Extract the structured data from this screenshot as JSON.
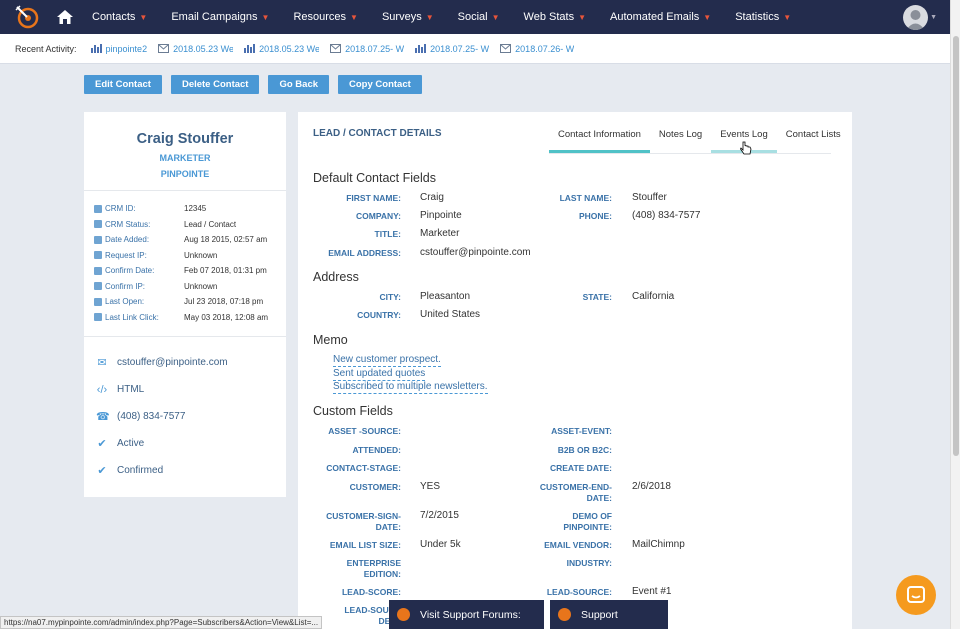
{
  "nav": {
    "items": [
      "Contacts",
      "Email Campaigns",
      "Resources",
      "Surveys",
      "Social",
      "Web Stats",
      "Automated Emails",
      "Statistics"
    ]
  },
  "recent": {
    "label": "Recent Activity:",
    "items": [
      {
        "text": "pinpointe2",
        "icon": "chart-icon"
      },
      {
        "text": "2018.05.23 We",
        "icon": "email-icon"
      },
      {
        "text": "2018.05.23 We",
        "icon": "chart-icon"
      },
      {
        "text": "2018.07.25- W",
        "icon": "email-icon"
      },
      {
        "text": "2018.07.25- W",
        "icon": "chart-icon"
      },
      {
        "text": "2018.07.26- W",
        "icon": "email-icon"
      }
    ]
  },
  "actions": {
    "edit": "Edit Contact",
    "delete": "Delete Contact",
    "back": "Go Back",
    "copy": "Copy Contact"
  },
  "profile": {
    "name": "Craig Stouffer",
    "title": "MARKETER",
    "company": "PINPOINTE",
    "meta": [
      {
        "label": "CRM ID:",
        "value": "12345"
      },
      {
        "label": "CRM Status:",
        "value": "Lead / Contact"
      },
      {
        "label": "Date Added:",
        "value": "Aug 18 2015, 02:57 am"
      },
      {
        "label": "Request IP:",
        "value": "Unknown"
      },
      {
        "label": "Confirm Date:",
        "value": "Feb 07 2018, 01:31 pm"
      },
      {
        "label": "Confirm IP:",
        "value": "Unknown"
      },
      {
        "label": "Last Open:",
        "value": "Jul 23 2018, 07:18 pm"
      },
      {
        "label": "Last Link Click:",
        "value": "May 03 2018, 12:08 am"
      }
    ],
    "contact": {
      "email": "cstouffer@pinpointe.com",
      "format": "HTML",
      "phone": "(408) 834-7577",
      "status": "Active",
      "confirmed": "Confirmed"
    }
  },
  "main": {
    "title": "LEAD / CONTACT DETAILS",
    "tabs": [
      "Contact Information",
      "Notes Log",
      "Events Log",
      "Contact Lists"
    ],
    "sections": {
      "default": "Default Contact Fields",
      "address": "Address",
      "memo": "Memo",
      "custom": "Custom Fields"
    },
    "default_fields": {
      "first_name_label": "FIRST NAME:",
      "first_name": "Craig",
      "last_name_label": "LAST NAME:",
      "last_name": "Stouffer",
      "company_label": "COMPANY:",
      "company": "Pinpointe",
      "phone_label": "PHONE:",
      "phone": "(408) 834-7577",
      "title_label": "TITLE:",
      "title": "Marketer",
      "email_label": "EMAIL ADDRESS:",
      "email": "cstouffer@pinpointe.com"
    },
    "address_fields": {
      "city_label": "CITY:",
      "city": "Pleasanton",
      "state_label": "STATE:",
      "state": "California",
      "country_label": "COUNTRY:",
      "country": "United States"
    },
    "memo": [
      "New customer prospect.",
      "Sent updated quotes",
      "Subscribed to multiple newsletters."
    ],
    "custom_fields": {
      "asset_source_label": "ASSET -SOURCE:",
      "asset_event_label": "ASSET-EVENT:",
      "attended_label": "ATTENDED:",
      "b2b_label": "B2B OR B2C:",
      "contact_stage_label": "CONTACT-STAGE:",
      "create_date_label": "CREATE DATE:",
      "customer_label": "CUSTOMER:",
      "customer": "YES",
      "customer_end_label_1": "CUSTOMER-END-",
      "customer_end_label_2": "DATE:",
      "customer_end": "2/6/2018",
      "customer_sign_label_1": "CUSTOMER-SIGN-",
      "customer_sign_label_2": "DATE:",
      "customer_sign": "7/2/2015",
      "demo_label_1": "DEMO OF",
      "demo_label_2": "PINPOINTE:",
      "list_size_label": "EMAIL LIST SIZE:",
      "list_size": "Under 5k",
      "vendor_label": "EMAIL VENDOR:",
      "vendor": "MailChimnp",
      "enterprise_label_1": "ENTERPRISE",
      "enterprise_label_2": "EDITION:",
      "industry_label": "INDUSTRY:",
      "lead_score_label": "LEAD-SCORE:",
      "lead_source_label": "LEAD-SOURCE:",
      "lead_source": "Event #1",
      "lead_source2_label_1": "LEAD-SOURC",
      "lead_source2_label_2": "DETA"
    }
  },
  "footer": {
    "url": "https://na07.mypinpointe.com/admin/index.php?Page=Subscribers&Action=View&List=...",
    "forums": "Visit Support Forums:",
    "support": "Support"
  },
  "colors": {
    "nav_bg": "#232c4d",
    "accent": "#4a98d5",
    "tab_active": "#50c2c7",
    "chat": "#f59a1e"
  }
}
